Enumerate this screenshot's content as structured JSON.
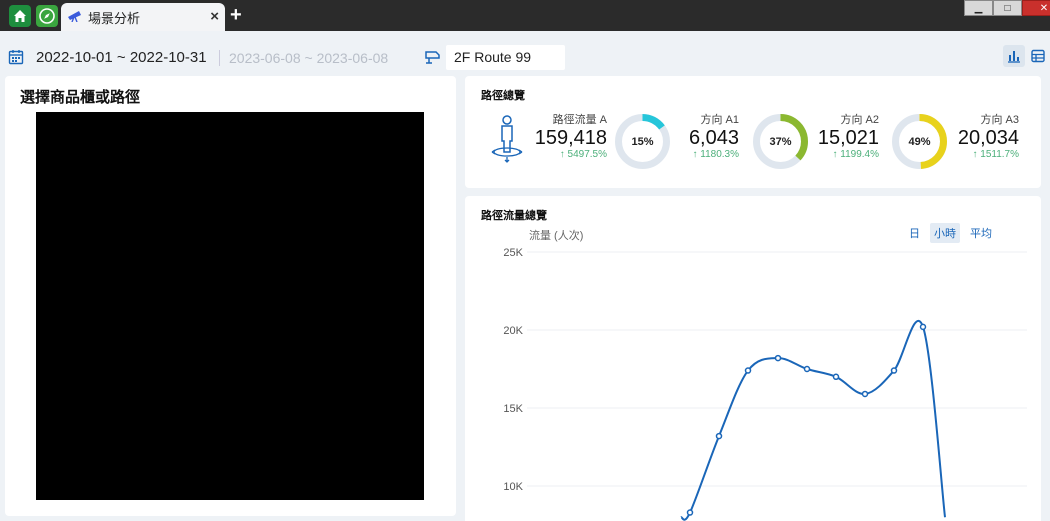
{
  "tab": {
    "label": "場景分析",
    "add_label": "+",
    "close_label": "×"
  },
  "window": {
    "minimize": "▁",
    "maximize": "□",
    "close": "✕"
  },
  "toolbar": {
    "date_range": "2022-10-01 ~ 2022-10-31",
    "compare_range": "2023-06-08 ~ 2023-06-08",
    "route": "2F Route 99"
  },
  "left_panel": {
    "title": "選擇商品櫃或路徑"
  },
  "summary": {
    "title": "路徑總覽",
    "total": {
      "label": "路徑流量 A",
      "value": "159,418",
      "change": "↑ 5497.5%"
    },
    "directions": [
      {
        "label": "方向 A1",
        "value": "6,043",
        "change": "↑ 1180.3%",
        "percent": "15%",
        "fraction": 0.15,
        "color": "#26c6da"
      },
      {
        "label": "方向 A2",
        "value": "15,021",
        "change": "↑ 1199.4%",
        "percent": "37%",
        "fraction": 0.37,
        "color": "#8bb830"
      },
      {
        "label": "方向 A3",
        "value": "20,034",
        "change": "↑ 1511.7%",
        "percent": "49%",
        "fraction": 0.49,
        "color": "#e8d21c"
      }
    ]
  },
  "chart_panel": {
    "title": "路徑流量總覽",
    "ylabel": "流量 (人次)",
    "tabs": [
      "日",
      "小時",
      "平均"
    ],
    "active_tab": "小時"
  },
  "chart_data": {
    "type": "line",
    "title": "路徑流量總覽",
    "ylabel": "流量 (人次)",
    "ylim": [
      0,
      25000
    ],
    "yticks": [
      "25K",
      "20K",
      "15K",
      "10K"
    ],
    "ytick_values": [
      25000,
      20000,
      15000,
      10000
    ],
    "grid": true,
    "series": [
      {
        "color": "#1a66b8",
        "points": [
          {
            "x": 0,
            "y": 8000
          },
          {
            "x": 1,
            "y": 8300
          },
          {
            "x": 2,
            "y": 13200
          },
          {
            "x": 3,
            "y": 17400
          },
          {
            "x": 4,
            "y": 18200
          },
          {
            "x": 5,
            "y": 17500
          },
          {
            "x": 6,
            "y": 17000
          },
          {
            "x": 7,
            "y": 15900
          },
          {
            "x": 8,
            "y": 17400
          },
          {
            "x": 9,
            "y": 20200
          },
          {
            "x": 10,
            "y": 8000
          }
        ]
      }
    ]
  },
  "colors": {
    "accent": "#1a66b8",
    "positive": "#4caf7a"
  }
}
